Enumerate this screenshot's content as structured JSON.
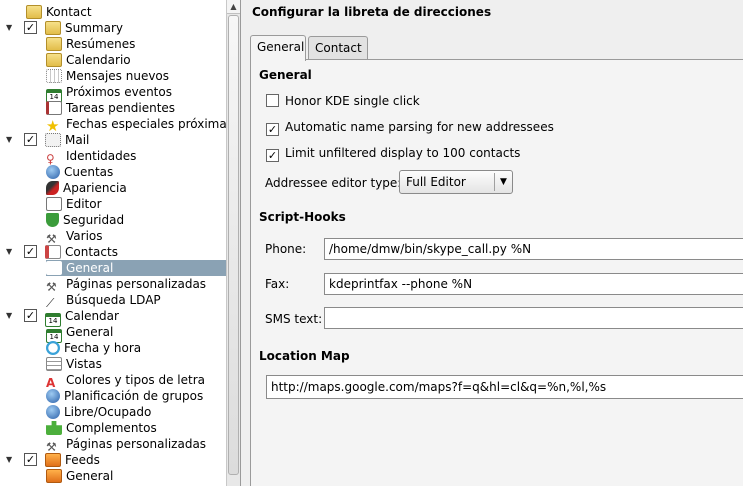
{
  "tree": {
    "items": [
      {
        "label": "Kontact",
        "icon": "folder-icon",
        "level": 0,
        "checkbox": false,
        "expandable": false
      },
      {
        "label": "Summary",
        "icon": "folder-icon",
        "level": 0,
        "checkbox": true,
        "checked": true,
        "expandable": true
      },
      {
        "label": "Resúmenes",
        "icon": "folder-icon",
        "level": 1
      },
      {
        "label": "Calendario",
        "icon": "folder-icon",
        "level": 1
      },
      {
        "label": "Mensajes nuevos",
        "icon": "grid-icon",
        "level": 1
      },
      {
        "label": "Próximos eventos",
        "icon": "calendar-icon",
        "level": 1
      },
      {
        "label": "Tareas pendientes",
        "icon": "note-icon",
        "level": 1
      },
      {
        "label": "Fechas especiales próximas",
        "icon": "star-icon",
        "level": 1
      },
      {
        "label": "Mail",
        "icon": "mail-icon",
        "level": 0,
        "checkbox": true,
        "checked": true,
        "expandable": true
      },
      {
        "label": "Identidades",
        "icon": "person-icon",
        "level": 1
      },
      {
        "label": "Cuentas",
        "icon": "globe-icon",
        "level": 1
      },
      {
        "label": "Apariencia",
        "icon": "brush-icon",
        "level": 1
      },
      {
        "label": "Editor",
        "icon": "edit-icon",
        "level": 1
      },
      {
        "label": "Seguridad",
        "icon": "shield-icon",
        "level": 1
      },
      {
        "label": "Varios",
        "icon": "tools-icon",
        "level": 1
      },
      {
        "label": "Contacts",
        "icon": "card-icon",
        "level": 0,
        "checkbox": true,
        "checked": true,
        "expandable": true
      },
      {
        "label": "General",
        "icon": "general-icon",
        "level": 1,
        "selected": true
      },
      {
        "label": "Páginas personalizadas",
        "icon": "tools-icon",
        "level": 1
      },
      {
        "label": "Búsqueda LDAP",
        "icon": "slash-icon",
        "level": 1
      },
      {
        "label": "Calendar",
        "icon": "calendar-icon",
        "level": 0,
        "checkbox": true,
        "checked": true,
        "expandable": true
      },
      {
        "label": "General",
        "icon": "calendar-icon",
        "level": 1
      },
      {
        "label": "Fecha y hora",
        "icon": "clock-icon",
        "level": 1
      },
      {
        "label": "Vistas",
        "icon": "list-icon",
        "level": 1
      },
      {
        "label": "Colores y tipos de letra",
        "icon": "fonts-icon",
        "level": 1
      },
      {
        "label": "Planificación de grupos",
        "icon": "globe-icon",
        "level": 1
      },
      {
        "label": "Libre/Ocupado",
        "icon": "globe-icon",
        "level": 1
      },
      {
        "label": "Complementos",
        "icon": "plugin-icon",
        "level": 1
      },
      {
        "label": "Páginas personalizadas",
        "icon": "tools-icon",
        "level": 1
      },
      {
        "label": "Feeds",
        "icon": "feed-icon",
        "level": 0,
        "checkbox": true,
        "checked": true,
        "expandable": true
      },
      {
        "label": "General",
        "icon": "feed-icon",
        "level": 1
      }
    ]
  },
  "panel": {
    "title": "Configurar la libreta de direcciones",
    "tabs": [
      "General",
      "Contact"
    ],
    "active_tab": "General"
  },
  "general": {
    "heading": "General",
    "honor_kde": {
      "label": "Honor KDE single click",
      "checked": false
    },
    "auto_name": {
      "label": "Automatic name parsing for new addressees",
      "checked": true
    },
    "limit_display": {
      "label": "Limit unfiltered display to 100 contacts",
      "checked": true
    },
    "editor_type_label": "Addressee editor type:",
    "editor_type_value": "Full Editor"
  },
  "script_hooks": {
    "heading": "Script-Hooks",
    "phone_label": "Phone:",
    "phone_value": "/home/dmw/bin/skype_call.py %N",
    "fax_label": "Fax:",
    "fax_value": "kdeprintfax --phone %N",
    "sms_label": "SMS text:",
    "sms_value": ""
  },
  "location_map": {
    "heading": "Location Map",
    "url": "http://maps.google.com/maps?f=q&hl=cl&q=%n,%l,%s"
  },
  "colors": {
    "selection": "#8aa2b4",
    "background": "#efefef"
  }
}
